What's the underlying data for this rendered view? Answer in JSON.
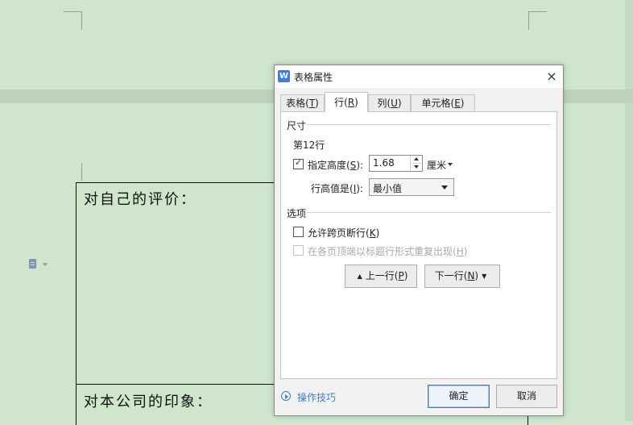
{
  "document": {
    "cell1_text": "对自己的评价：",
    "cell2_text": "对本公司的印象："
  },
  "dialog": {
    "title": "表格属性",
    "app_icon_letter": "W",
    "close_icon": "×",
    "tabs": [
      {
        "label": "表格",
        "key": "T",
        "active": false
      },
      {
        "label": "行",
        "key": "R",
        "active": true
      },
      {
        "label": "列",
        "key": "U",
        "active": false
      },
      {
        "label": "单元格",
        "key": "E",
        "active": false
      }
    ],
    "size_group": "尺寸",
    "row_label": "第12行",
    "specify_height": {
      "label": "指定高度",
      "key": "S",
      "checked": true
    },
    "height_value": "1.68",
    "unit": "厘米",
    "row_height_is": {
      "label": "行高值是",
      "key": "I"
    },
    "row_height_mode": "最小值",
    "options_group": "选项",
    "allow_break": {
      "label": "允许跨页断行",
      "key": "K",
      "checked": false
    },
    "repeat_header": {
      "label": "在各页顶端以标题行形式重复出现",
      "key": "H",
      "checked": false
    },
    "prev_row": {
      "label": "上一行",
      "key": "P"
    },
    "next_row": {
      "label": "下一行",
      "key": "N"
    },
    "help_link": "操作技巧",
    "ok": "确定",
    "cancel": "取消"
  },
  "colors": {
    "document_background": "#cfe6cd",
    "accent": "#3a7bd5"
  }
}
